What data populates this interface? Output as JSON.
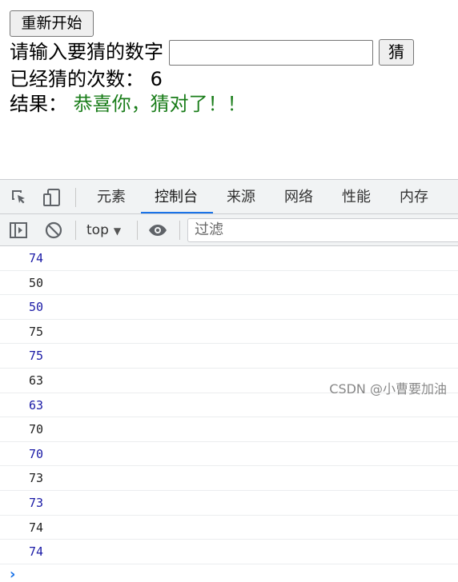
{
  "page": {
    "restart_label": "重新开始",
    "input_label": "请输入要猜的数字",
    "input_value": "",
    "guess_label": "猜",
    "count_label": "已经猜的次数：",
    "count_value": "6",
    "result_label": "结果：",
    "result_text": "恭喜你，猜对了！！",
    "result_color": "#1a7d1a"
  },
  "devtools": {
    "tabs": [
      "元素",
      "控制台",
      "来源",
      "网络",
      "性能",
      "内存"
    ],
    "active_tab": "控制台",
    "context": "top",
    "filter_placeholder": "过滤",
    "logs": [
      {
        "value": "74",
        "color": "#1a1aa6"
      },
      {
        "value": "50",
        "color": "#222222"
      },
      {
        "value": "50",
        "color": "#1a1aa6"
      },
      {
        "value": "75",
        "color": "#222222"
      },
      {
        "value": "75",
        "color": "#1a1aa6"
      },
      {
        "value": "63",
        "color": "#222222"
      },
      {
        "value": "63",
        "color": "#1a1aa6"
      },
      {
        "value": "70",
        "color": "#222222"
      },
      {
        "value": "70",
        "color": "#1a1aa6"
      },
      {
        "value": "73",
        "color": "#222222"
      },
      {
        "value": "73",
        "color": "#1a1aa6"
      },
      {
        "value": "74",
        "color": "#222222"
      },
      {
        "value": "74",
        "color": "#1a1aa6"
      }
    ],
    "prompt_symbol": "›",
    "accent_color": "#1a73e8"
  },
  "watermark": "CSDN @小曹要加油",
  "icons": [
    "inspect-element-icon",
    "device-toolbar-icon",
    "sidebar-toggle-icon",
    "clear-console-icon",
    "eye-icon"
  ]
}
